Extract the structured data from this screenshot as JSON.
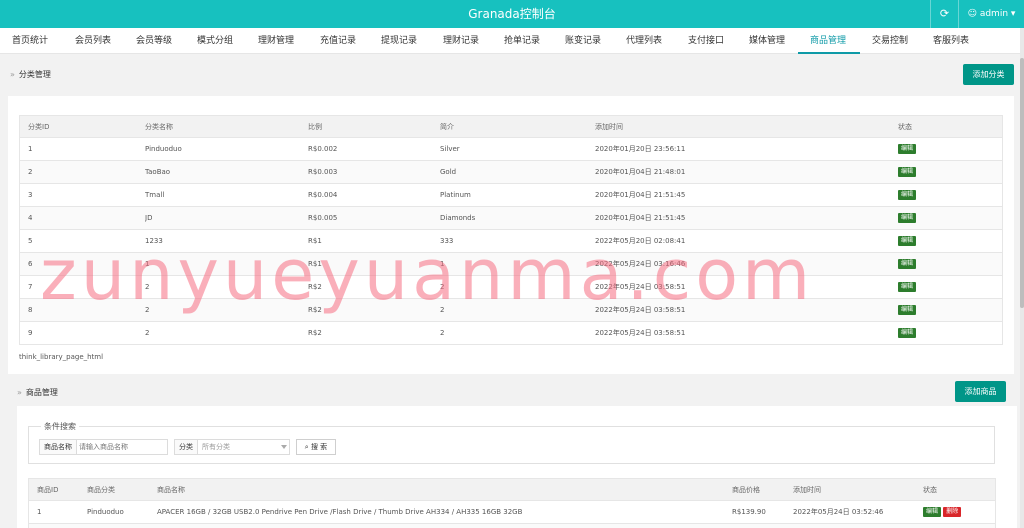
{
  "app": {
    "title": "Granada控制台",
    "user": "admin",
    "refresh_icon": "refresh-icon",
    "user_icon": "user-icon"
  },
  "nav": [
    {
      "label": "首页统计"
    },
    {
      "label": "会员列表"
    },
    {
      "label": "会员等级"
    },
    {
      "label": "模式分组"
    },
    {
      "label": "理财管理"
    },
    {
      "label": "充值记录"
    },
    {
      "label": "提现记录"
    },
    {
      "label": "理财记录"
    },
    {
      "label": "抢单记录"
    },
    {
      "label": "账变记录"
    },
    {
      "label": "代理列表"
    },
    {
      "label": "支付接口"
    },
    {
      "label": "媒体管理"
    },
    {
      "label": "商品管理",
      "active": true
    },
    {
      "label": "交易控制"
    },
    {
      "label": "客服列表"
    }
  ],
  "category_section": {
    "breadcrumb": "分类管理",
    "add_button": "添加分类",
    "columns": [
      "分类ID",
      "分类名称",
      "比例",
      "简介",
      "添加时间",
      "状态"
    ],
    "rows": [
      [
        "1",
        "Pinduoduo",
        "R$0.002",
        "Silver",
        "2020年01月20日 23:56:11",
        "编辑"
      ],
      [
        "2",
        "TaoBao",
        "R$0.003",
        "Gold",
        "2020年01月04日 21:48:01",
        "编辑"
      ],
      [
        "3",
        "Tmall",
        "R$0.004",
        "Platinum",
        "2020年01月04日 21:51:45",
        "编辑"
      ],
      [
        "4",
        "JD",
        "R$0.005",
        "Diamonds",
        "2020年01月04日 21:51:45",
        "编辑"
      ],
      [
        "5",
        "1233",
        "R$1",
        "333",
        "2022年05月20日 02:08:41",
        "编辑"
      ],
      [
        "6",
        "1",
        "R$1",
        "1",
        "2022年05月24日 03:16:46",
        "编辑"
      ],
      [
        "7",
        "2",
        "R$2",
        "2",
        "2022年05月24日 03:58:51",
        "编辑"
      ],
      [
        "8",
        "2",
        "R$2",
        "2",
        "2022年05月24日 03:58:51",
        "编辑"
      ],
      [
        "9",
        "2",
        "R$2",
        "2",
        "2022年05月24日 03:58:51",
        "编辑"
      ]
    ],
    "pager_text": "think_library_page_html"
  },
  "goods_section": {
    "breadcrumb": "商品管理",
    "add_button": "添加商品",
    "search": {
      "legend": "条件搜索",
      "name_label": "商品名称",
      "name_placeholder": "请输入商品名称",
      "category_label": "分类",
      "category_value": "所有分类",
      "search_button": "搜 索",
      "search_icon": "search-icon"
    },
    "columns": [
      "商品ID",
      "商品分类",
      "商品名称",
      "商品价格",
      "添加时间",
      "状态"
    ],
    "rows": [
      [
        "1",
        "Pinduoduo",
        "APACER 16GB / 32GB USB2.0 Pendrive Pen Drive /Flash Drive / Thumb Drive AH334 / AH335 16GB 32GB",
        "R$139.90",
        "2022年05月24日 03:52:46"
      ]
    ],
    "row_actions": [
      "编辑",
      "删除"
    ]
  },
  "watermark": "zunyueyuanma.com",
  "colors": {
    "topbar": "#17c1bf",
    "accent": "#0e9aa7",
    "primary_button": "#009688",
    "edit_tag": "#2d7d2d",
    "delete_tag": "#d9262a"
  }
}
